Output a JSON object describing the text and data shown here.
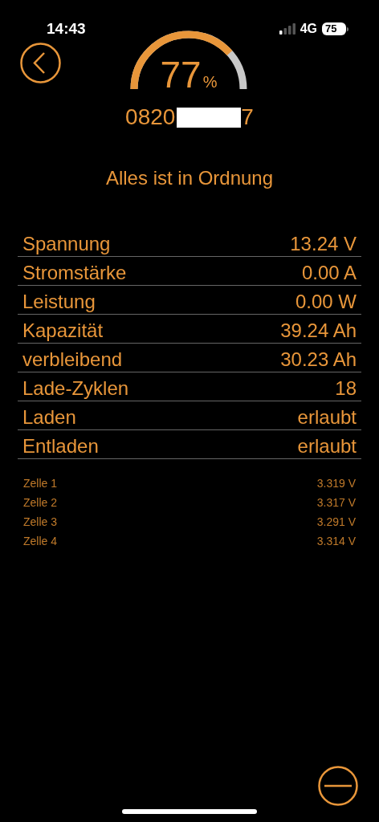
{
  "status_bar": {
    "time": "14:43",
    "network": "4G",
    "battery": "75"
  },
  "gauge": {
    "value": "77",
    "unit": "%"
  },
  "serial": {
    "start": "0820",
    "end": "7"
  },
  "message": "Alles ist in Ordnung",
  "readings": [
    {
      "label": "Spannung",
      "value": "13.24 V"
    },
    {
      "label": "Stromstärke",
      "value": "0.00 A"
    },
    {
      "label": "Leistung",
      "value": "0.00 W"
    },
    {
      "label": "Kapazität",
      "value": "39.24 Ah"
    },
    {
      "label": "verbleibend",
      "value": "30.23 Ah"
    },
    {
      "label": "Lade-Zyklen",
      "value": "18"
    },
    {
      "label": "Laden",
      "value": "erlaubt"
    },
    {
      "label": "Entladen",
      "value": "erlaubt"
    }
  ],
  "cells": [
    {
      "label": "Zelle 1",
      "value": "3.319 V"
    },
    {
      "label": "Zelle 2",
      "value": "3.317 V"
    },
    {
      "label": "Zelle 3",
      "value": "3.291 V"
    },
    {
      "label": "Zelle 4",
      "value": "3.314 V"
    }
  ]
}
